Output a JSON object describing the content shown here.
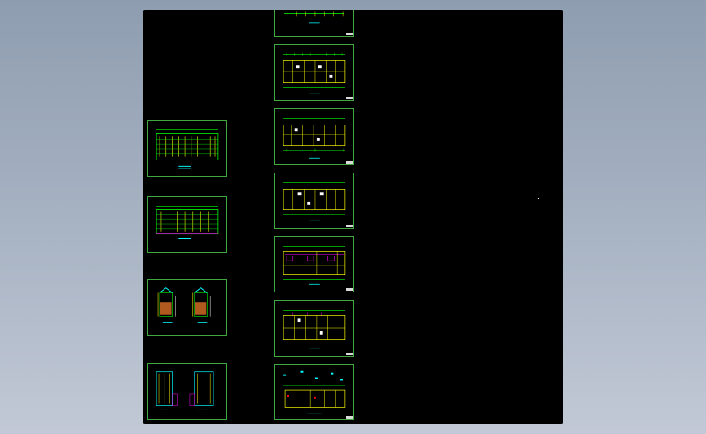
{
  "window": {
    "title": ""
  },
  "drawing": {
    "background": "#000000",
    "sheet_border_color": "#3fa83f",
    "line_colors": [
      "#00ff00",
      "#ffff00",
      "#00ffff",
      "#ff00ff",
      "#ff0000",
      "#ffffff"
    ],
    "sheets_left": [
      {
        "kind": "elevation-plan"
      },
      {
        "kind": "elevation-plan"
      },
      {
        "kind": "section-pair"
      },
      {
        "kind": "detail-pair"
      }
    ],
    "sheets_right": [
      {
        "kind": "floor-plan-partial"
      },
      {
        "kind": "floor-plan"
      },
      {
        "kind": "floor-plan"
      },
      {
        "kind": "floor-plan"
      },
      {
        "kind": "floor-plan"
      },
      {
        "kind": "floor-plan"
      },
      {
        "kind": "site-plan"
      }
    ]
  }
}
